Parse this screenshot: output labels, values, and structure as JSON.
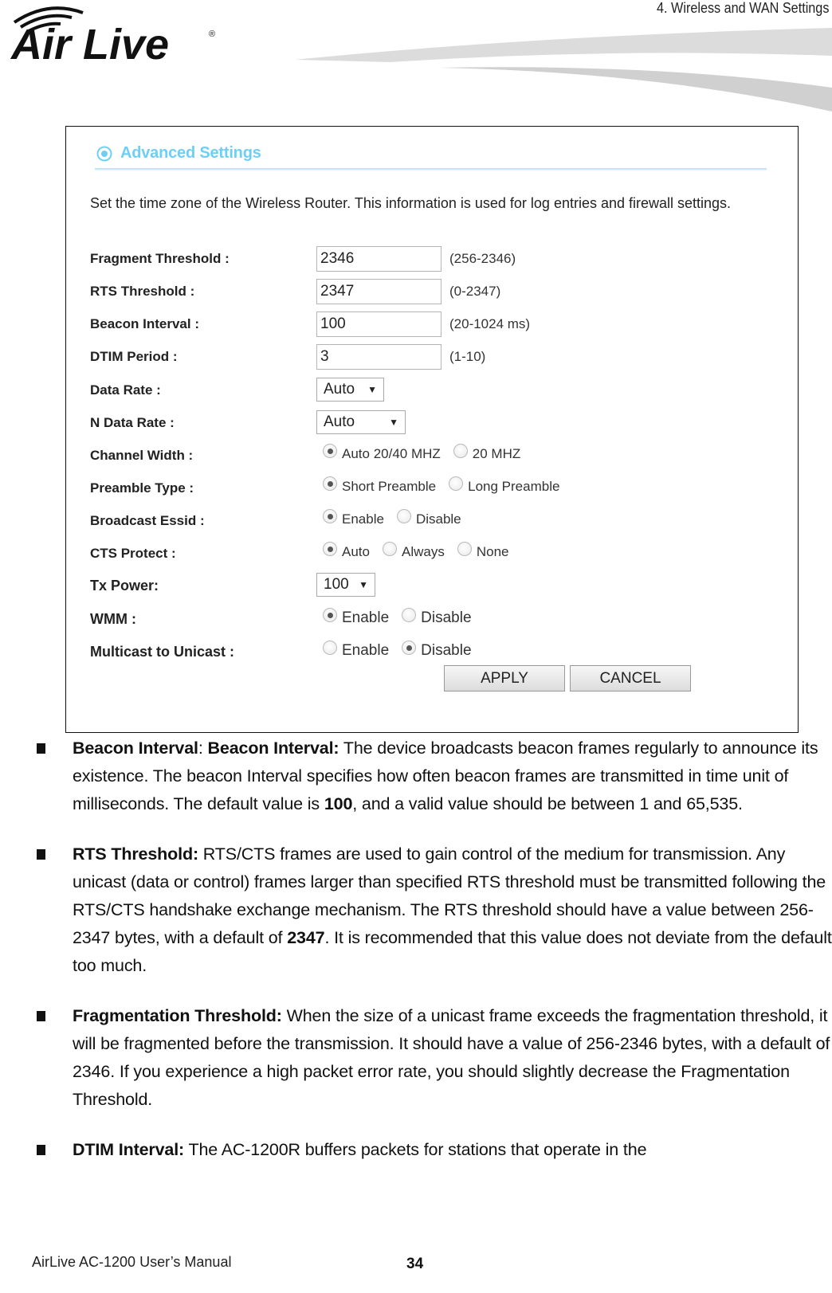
{
  "header": {
    "chapter_title": "4. Wireless and WAN Settings",
    "logo_text": "Air Live"
  },
  "screenshot": {
    "section_title": "Advanced Settings",
    "intro": "Set the time zone of the Wireless Router. This information is used for log entries and firewall settings.",
    "fields": {
      "fragment_threshold": {
        "label": "Fragment Threshold :",
        "value": "2346",
        "hint": "(256-2346)"
      },
      "rts_threshold": {
        "label": "RTS Threshold :",
        "value": "2347",
        "hint": "(0-2347)"
      },
      "beacon_interval": {
        "label": "Beacon Interval :",
        "value": "100",
        "hint": "(20-1024 ms)"
      },
      "dtim_period": {
        "label": "DTIM Period :",
        "value": "3",
        "hint": "(1-10)"
      },
      "data_rate": {
        "label": "Data Rate :",
        "selected": "Auto"
      },
      "n_data_rate": {
        "label": "N Data Rate :",
        "selected": "Auto"
      },
      "channel_width": {
        "label": "Channel Width :",
        "options": [
          "Auto 20/40 MHZ",
          "20 MHZ"
        ],
        "selected_index": 0
      },
      "preamble_type": {
        "label": "Preamble Type :",
        "options": [
          "Short Preamble",
          "Long Preamble"
        ],
        "selected_index": 0
      },
      "broadcast_essid": {
        "label": "Broadcast Essid :",
        "options": [
          "Enable",
          "Disable"
        ],
        "selected_index": 0
      },
      "cts_protect": {
        "label": "CTS Protect :",
        "options": [
          "Auto",
          "Always",
          "None"
        ],
        "selected_index": 0
      },
      "tx_power": {
        "label": "Tx Power:",
        "selected": "100"
      },
      "wmm": {
        "label": "WMM :",
        "options": [
          "Enable",
          "Disable"
        ],
        "selected_index": 0
      },
      "multicast_to_unicast": {
        "label": "Multicast to Unicast :",
        "options": [
          "Enable",
          "Disable"
        ],
        "selected_index": 1
      }
    },
    "buttons": {
      "apply": "APPLY",
      "cancel": "CANCEL"
    }
  },
  "body": {
    "bullets": [
      {
        "lead": "Beacon Interval",
        "lead_sep": ": ",
        "lead2": "Beacon Interval:",
        "text_parts": [
          " The device broadcasts beacon frames regularly to announce its existence. The beacon Interval specifies how often beacon frames are transmitted in time unit of milliseconds. The default value is ",
          "100",
          ", and a valid value should be between 1 and 65,535."
        ]
      },
      {
        "lead": "RTS Threshold:",
        "text_parts": [
          " RTS/CTS frames are used to gain control of the medium for transmission. Any unicast (data or control) frames larger than specified RTS threshold must be transmitted following the RTS/CTS handshake exchange mechanism. The RTS threshold should have a value between 256-2347 bytes, with a default of ",
          "2347",
          ". It is recommended that this value does not deviate from the default too much."
        ]
      },
      {
        "lead": "Fragmentation Threshold:",
        "text": " When the size of a unicast frame exceeds the fragmentation threshold, it will be fragmented before the transmission. It should have a value of 256-2346 bytes, with a default of 2346. If you experience a high packet error rate, you should slightly decrease the Fragmentation Threshold."
      },
      {
        "lead": "DTIM Interval:",
        "text": " The AC-1200R buffers packets for stations that operate in the"
      }
    ]
  },
  "footer": {
    "manual_title": "AirLive AC-1200 User’s Manual",
    "page_number": "34"
  },
  "colors": {
    "section_title": "#6ecff6",
    "text": "#111111"
  }
}
